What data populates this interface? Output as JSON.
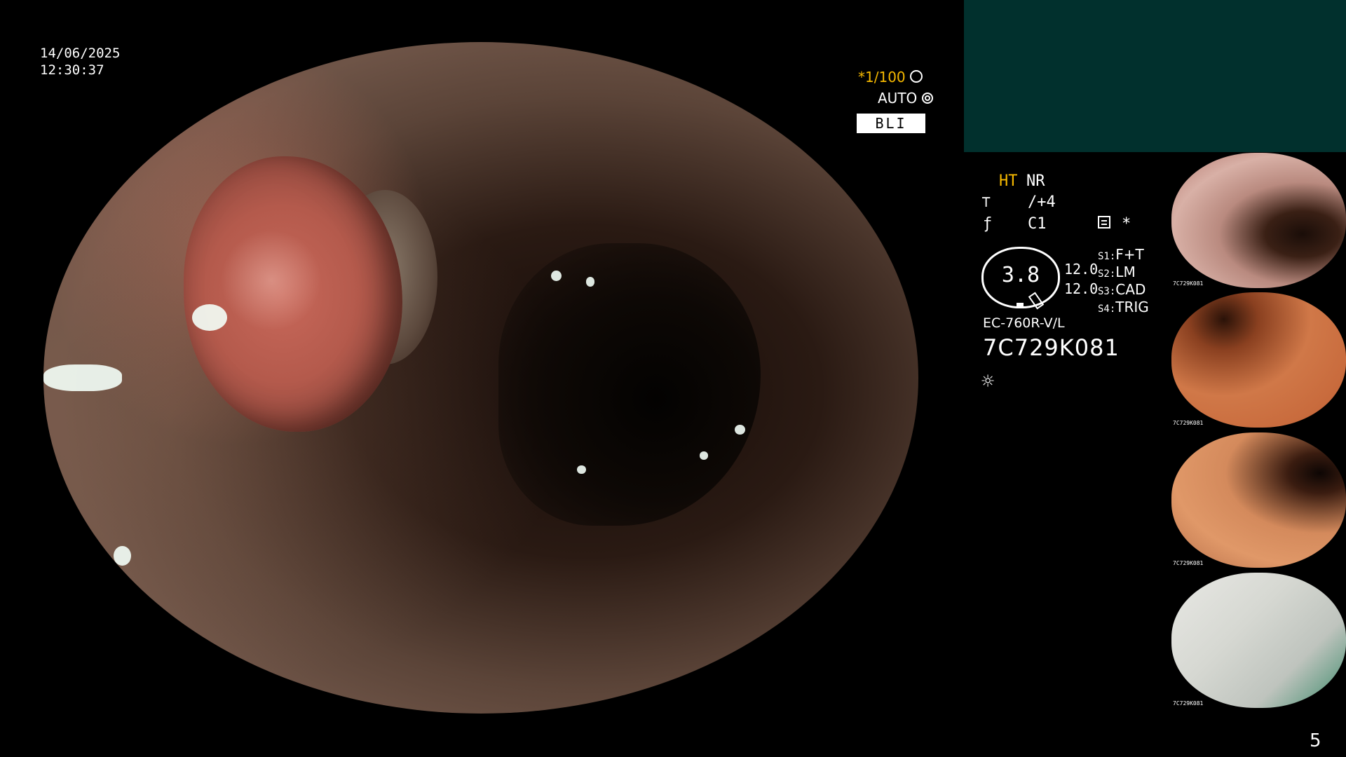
{
  "overlay": {
    "date": "14/06/2025",
    "time": "12:30:37",
    "shutter_label": "*1/100",
    "shutter_icon": "aperture-icon",
    "auto_label": "AUTO",
    "auto_icon": "iris-icon",
    "mode_label": "BLI",
    "mode_color": "#ffffff",
    "accent_color": "#f5b800"
  },
  "status": {
    "ht_label": "HT",
    "nr_label": "NR",
    "enhance_icon": "enhance-icon",
    "enhance_value": "/+4",
    "color_icon": "color-icon",
    "color_value": "C1",
    "memory_icon": "memory-card-icon",
    "memory_mark": "*",
    "gauge_value": "3.8",
    "value1": "12.0",
    "value2": "12.0",
    "switches": [
      {
        "label": "S1:",
        "value": "F+T"
      },
      {
        "label": "S2:",
        "value": "LM"
      },
      {
        "label": "S3:",
        "value": "CAD"
      },
      {
        "label": "S4:",
        "value": "TRIG"
      }
    ],
    "scope_model": "EC-760R-V/L",
    "serial": "7C729K081",
    "light_icon": "light-source-icon"
  },
  "thumbnails": [
    {
      "caption": "7C729K081"
    },
    {
      "caption": "7C729K081"
    },
    {
      "caption": "7C729K081"
    },
    {
      "caption": "7C729K081"
    }
  ],
  "page_number": "5",
  "colors": {
    "panel_teal": "#01302d"
  }
}
